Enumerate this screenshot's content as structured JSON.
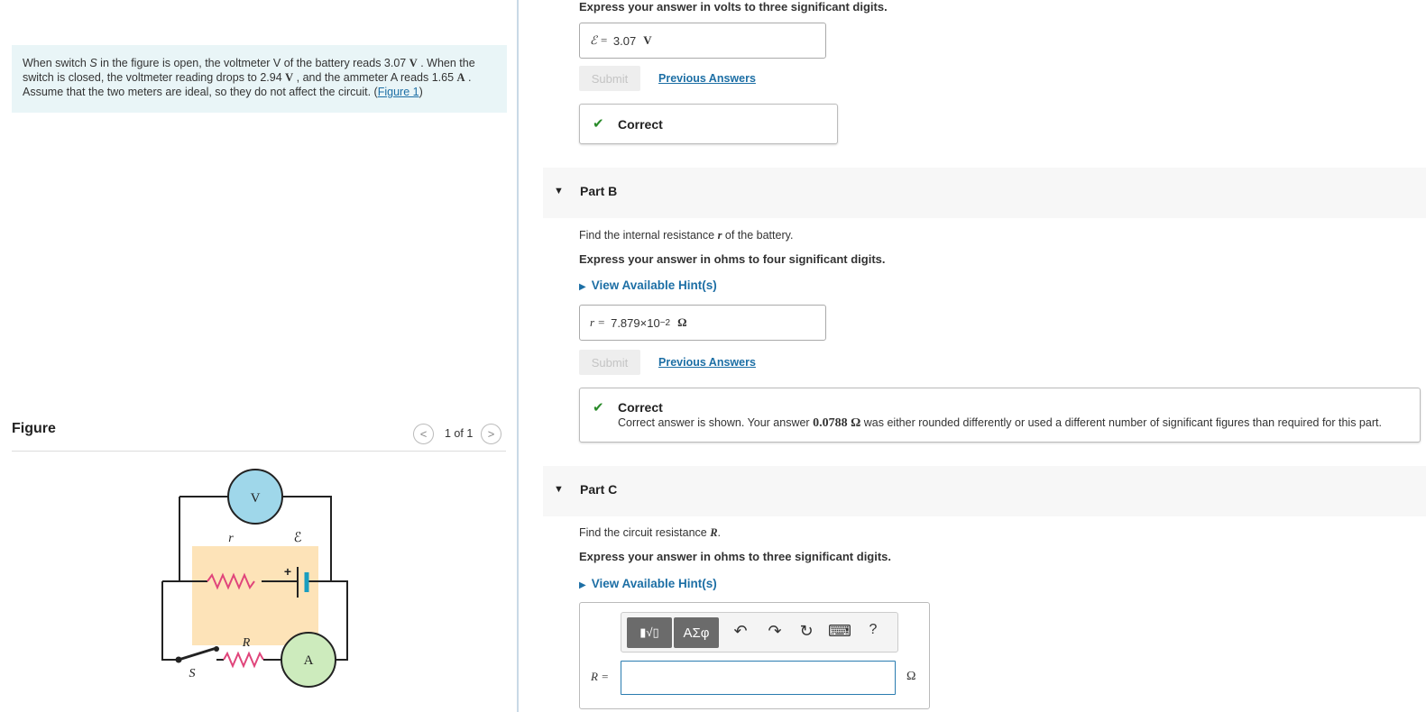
{
  "problem": {
    "t1": "When switch ",
    "switch_sym": "S",
    "t2": " in the figure is open, the voltmeter V of the battery reads 3.07 ",
    "u1": "V",
    "t3": " . When the switch is closed, the voltmeter reading drops to 2.94 ",
    "u2": "V",
    "t4": " , and the ammeter A reads 1.65 ",
    "u3": "A",
    "t5": " . Assume that the two meters are ideal, so they do not affect the circuit. (",
    "link": "Figure 1",
    "t6": ")"
  },
  "figure": {
    "title": "Figure",
    "count": "1 of 1",
    "prev_glyph": "<",
    "next_glyph": ">",
    "labels": {
      "voltmeter": "V",
      "ammeter": "A",
      "r": "r",
      "emf": "ℰ",
      "R": "R",
      "S": "S",
      "plus": "+"
    }
  },
  "partA": {
    "instruction": "Express your answer in volts to three significant digits.",
    "symbol": "ℰ =",
    "value": "3.07",
    "unit": "V",
    "submit": "Submit",
    "previous": "Previous Answers",
    "check": "✔",
    "feedback_title": "Correct"
  },
  "partB": {
    "header": "Part B",
    "question_pre": "Find the internal resistance ",
    "question_sym": "r",
    "question_post": " of the battery.",
    "instruction": "Express your answer in ohms to four significant digits.",
    "hint": "View Available Hint(s)",
    "symbol": "r =",
    "value_mantissa": "7.879×10",
    "value_exp": "−2",
    "unit": "Ω",
    "submit": "Submit",
    "previous": "Previous Answers",
    "check": "✔",
    "feedback_title": "Correct",
    "feedback_pre": "Correct answer is shown. Your answer ",
    "feedback_value": "0.0788 Ω",
    "feedback_post": " was either rounded differently or used a different number of significant figures than required for this part."
  },
  "partC": {
    "header": "Part C",
    "question_pre": "Find the circuit resistance ",
    "question_sym": "R",
    "question_post": ".",
    "instruction": "Express your answer in ohms to three significant digits.",
    "hint": "View Available Hint(s)",
    "symbol": "R =",
    "value": "",
    "unit": "Ω",
    "toolbar": {
      "templates": "▮√▯",
      "symbols": "ΑΣφ",
      "undo": "↶",
      "redo": "↷",
      "reset": "↻",
      "keyboard": "⌨",
      "help": "?"
    }
  },
  "colors": {
    "problem_bg": "#e9f5f7",
    "link": "#1d6fa5",
    "correct": "#2a8b2a",
    "voltmeter_fill": "#9fd7ea",
    "ammeter_fill": "#cdebbd",
    "battery_box": "#fde3b8",
    "resistor": "#e0457b",
    "battery_plate": "#1a9ec0"
  }
}
